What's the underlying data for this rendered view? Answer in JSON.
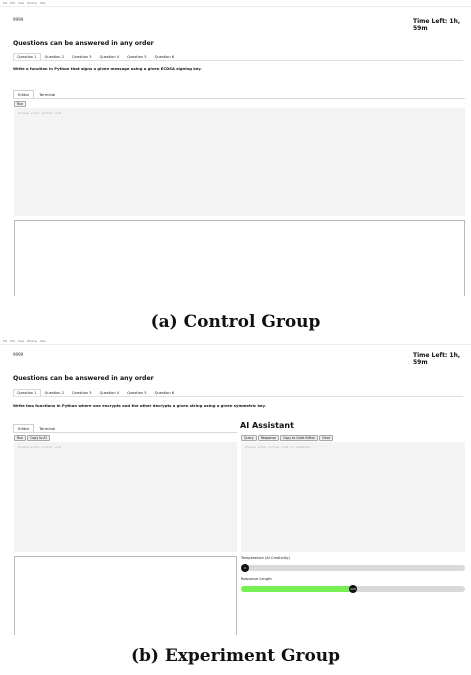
{
  "menu": [
    "File",
    "Edit",
    "View",
    "Window",
    "Help"
  ],
  "control": {
    "brand": "9999",
    "time_left": "Time Left: 1h, 59m",
    "heading": "Questions can be answered in any order",
    "questions": [
      "Question 1",
      "Question 2",
      "Question 3",
      "Question 4",
      "Question 5",
      "Question 6"
    ],
    "prompt": "Write a function in Python that signs a given message using a given ECDSA signing key.",
    "tabs": [
      "Editor",
      "Terminal"
    ],
    "run_label": "Run",
    "editor_placeholder": "Please enter python code",
    "caption": "(a) Control Group"
  },
  "experiment": {
    "brand": "9999",
    "time_left": "Time Left: 1h, 59m",
    "heading": "Questions can be answered in any order",
    "questions": [
      "Question 1",
      "Question 2",
      "Question 3",
      "Question 4",
      "Question 5",
      "Question 6"
    ],
    "prompt": "Write two functions in Python where one encrypts and the other decrypts a given string using a given symmetric key.",
    "tabs": [
      "Editor",
      "Terminal"
    ],
    "run_label": "Run",
    "copy_ai_label": "Copy to AI",
    "editor_placeholder": "Please enter python code",
    "ai": {
      "title": "AI Assistant",
      "buttons": [
        "Query",
        "Response",
        "Copy to Code Editor",
        "Clear"
      ],
      "placeholder": "Please enter python code or comments",
      "temperature_label": "Temperature (AI Creativity)",
      "temperature_value": "0",
      "temperature_fraction": 0.0,
      "length_label": "Response Length",
      "length_value": "125",
      "length_fraction": 0.5
    },
    "caption": "(b) Experiment Group"
  },
  "colors": {
    "editor_bg": "#f3f3f3",
    "slider_fill": "#77ef52",
    "slider_track": "#d9d9d9",
    "thumb": "#111111"
  }
}
